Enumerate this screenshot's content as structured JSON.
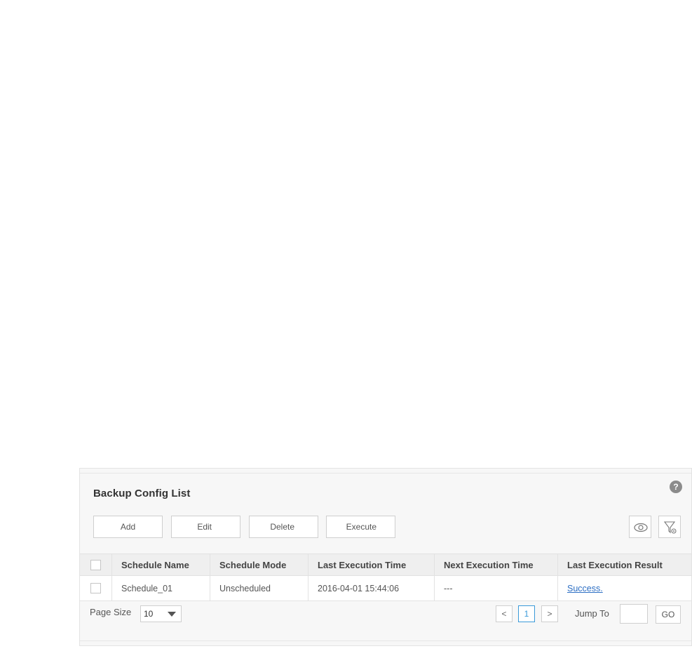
{
  "panel": {
    "title": "Backup Config List",
    "help_icon": "?"
  },
  "toolbar": {
    "add_label": "Add",
    "edit_label": "Edit",
    "delete_label": "Delete",
    "execute_label": "Execute",
    "view_icon": "eye-icon",
    "filter_icon": "filter-settings-icon"
  },
  "table": {
    "columns": [
      "Schedule Name",
      "Schedule Mode",
      "Last Execution Time",
      "Next Execution Time",
      "Last Execution Result"
    ],
    "rows": [
      {
        "schedule_name": "Schedule_01",
        "schedule_mode": "Unscheduled",
        "last_execution_time": "2016-04-01 15:44:06",
        "next_execution_time": "---",
        "last_execution_result": "Success."
      }
    ]
  },
  "footer": {
    "page_size_label": "Page Size",
    "page_size_value": "10",
    "prev_label": "<",
    "current_page": "1",
    "next_label": ">",
    "jump_to_label": "Jump To",
    "jump_input_value": "",
    "go_label": "GO"
  },
  "colors": {
    "accent": "#3a9ad9",
    "link": "#2d6fc4",
    "panel_bg": "#f7f7f7"
  }
}
